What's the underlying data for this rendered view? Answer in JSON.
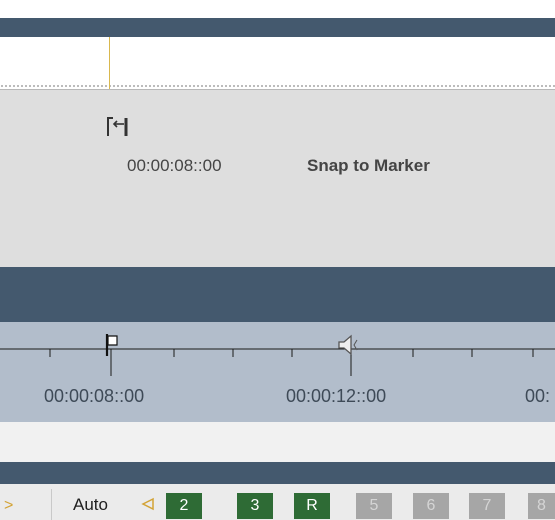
{
  "snap": {
    "time": "00:00:08::00",
    "label": "Snap to Marker",
    "icon": "snap-to-marker-icon"
  },
  "ruler": {
    "labels": [
      "00:00:08::00",
      "00:00:12::00",
      "00:"
    ],
    "icons": [
      "marker-flag-icon",
      "speaker-icon"
    ]
  },
  "toolbar": {
    "arrow": ">",
    "auto_label": "Auto",
    "buttons": [
      {
        "label": "2",
        "active": true
      },
      {
        "label": "3",
        "active": true
      },
      {
        "label": "R",
        "active": true
      },
      {
        "label": "5",
        "active": false
      },
      {
        "label": "6",
        "active": false
      },
      {
        "label": "7",
        "active": false
      },
      {
        "label": "8",
        "active": false
      }
    ]
  },
  "colors": {
    "dark_band": "#44596e",
    "ruler_bg": "#b2bdcb",
    "active_button": "#2e6b35",
    "inactive_button": "#a6a6a6",
    "playhead": "#d9b84e"
  }
}
